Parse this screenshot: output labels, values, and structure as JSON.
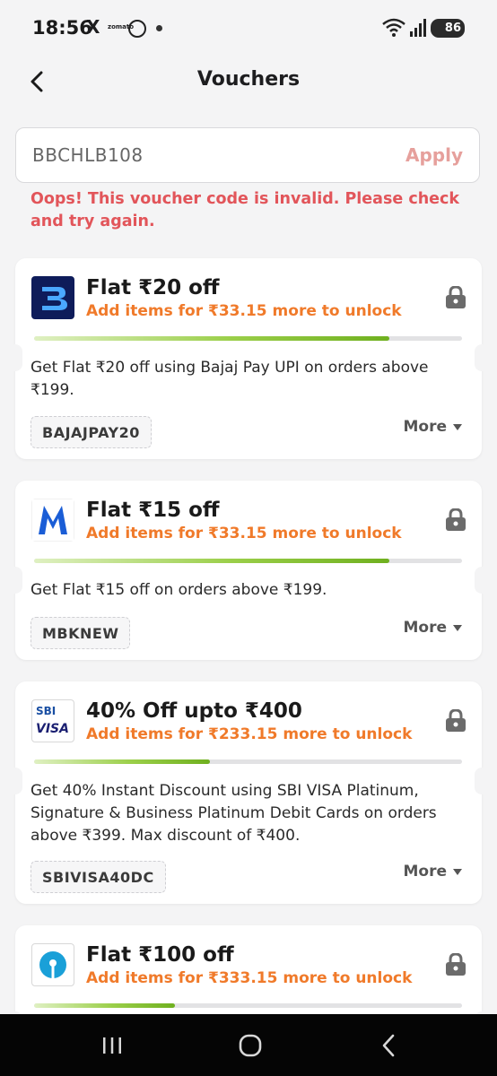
{
  "status_bar": {
    "time": "18:56",
    "x_glyph": "X",
    "zomato_text": "zomato",
    "battery": "86"
  },
  "header": {
    "title": "Vouchers",
    "back_icon": "chevron-left-icon"
  },
  "voucher_input": {
    "value": "BBCHLB108",
    "apply_label": "Apply",
    "error": "Oops! This voucher code is invalid. Please check and try again."
  },
  "colors": {
    "accent_orange": "#f07a2a",
    "error_red": "#e2555a",
    "apply_disabled": "#e6a09c",
    "progress_green": "#6fb01f"
  },
  "vouchers": [
    {
      "title": "Flat ₹20 off",
      "subtitle": "Add items for ₹33.15 more to unlock",
      "progress": 0.83,
      "description": "Get Flat ₹20 off using Bajaj Pay UPI on orders above ₹199.",
      "code": "BAJAJPAY20",
      "more_label": "More",
      "logo": "bajaj-pay-logo"
    },
    {
      "title": "Flat ₹15 off",
      "subtitle": "Add items for ₹33.15 more to unlock",
      "progress": 0.83,
      "description": "Get Flat ₹15 off on orders above ₹199.",
      "code": "MBKNEW",
      "more_label": "More",
      "logo": "mobikwik-logo"
    },
    {
      "title": "40% Off upto ₹400",
      "subtitle": "Add items for ₹233.15 more to unlock",
      "progress": 0.41,
      "description": "Get 40% Instant Discount using  SBI VISA Platinum, Signature & Business Platinum Debit Cards on orders above ₹399. Max discount of ₹400.",
      "code": "SBIVISA40DC",
      "more_label": "More",
      "logo": "sbi-visa-logo",
      "logo_text_1": "SBI",
      "logo_text_2": "VISA"
    },
    {
      "title": "Flat ₹100 off",
      "subtitle": "Add items for ₹333.15 more to unlock",
      "progress": 0.33,
      "logo": "sbi-logo"
    }
  ],
  "nav_bar": {
    "recents_icon": "recents-icon",
    "home_icon": "home-icon",
    "back_icon": "back-icon"
  }
}
